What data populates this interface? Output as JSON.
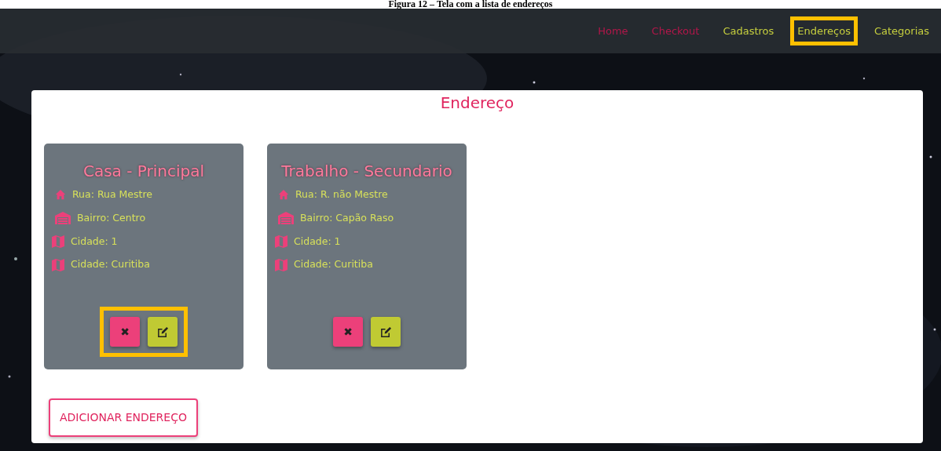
{
  "caption": "Figura 12 – Tela com a lista de endereços",
  "nav": [
    {
      "label": "Home",
      "kind": "muted",
      "highlighted": false
    },
    {
      "label": "Checkout",
      "kind": "muted",
      "highlighted": false
    },
    {
      "label": "Cadastros",
      "kind": "bright",
      "highlighted": false
    },
    {
      "label": "Endereços",
      "kind": "bright",
      "highlighted": true
    },
    {
      "label": "Categorias",
      "kind": "bright",
      "highlighted": false
    }
  ],
  "page_title": "Endereço",
  "cards": [
    {
      "title": "Casa - Principal",
      "actions_highlighted": true,
      "rows": [
        {
          "kind": "house",
          "text": "Rua: Rua Mestre"
        },
        {
          "kind": "warehouse",
          "text": "Bairro: Centro"
        },
        {
          "kind": "map",
          "text": "Cidade: 1"
        },
        {
          "kind": "map",
          "text": "Cidade: Curitiba"
        }
      ],
      "delete_label": "✖"
    },
    {
      "title": "Trabalho - Secundario",
      "actions_highlighted": false,
      "rows": [
        {
          "kind": "house",
          "text": "Rua: R. não Mestre"
        },
        {
          "kind": "warehouse",
          "text": "Bairro: Capão Raso"
        },
        {
          "kind": "map",
          "text": "Cidade: 1"
        },
        {
          "kind": "map",
          "text": "Cidade: Curitiba"
        }
      ],
      "delete_label": "✖"
    }
  ],
  "add_button": "ADICIONAR ENDEREÇO"
}
